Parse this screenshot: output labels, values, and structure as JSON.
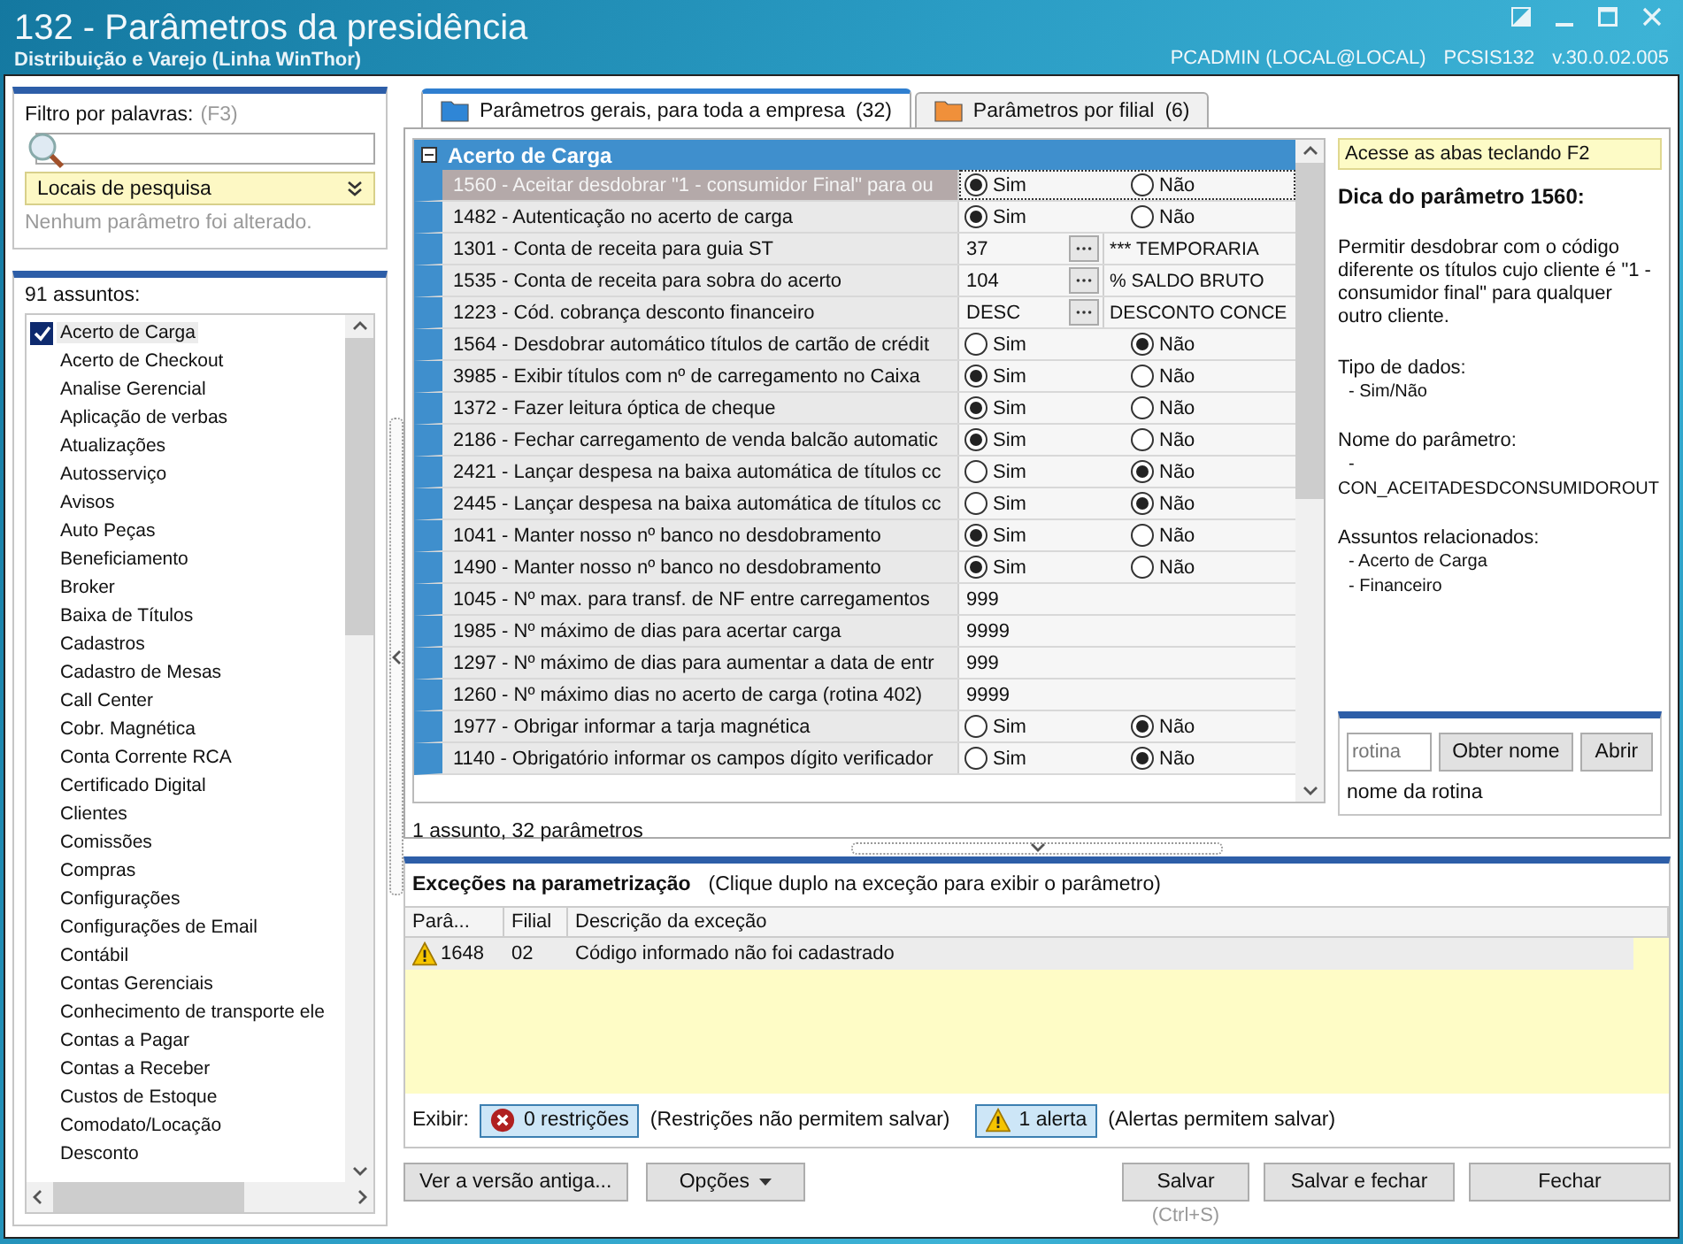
{
  "window": {
    "title": "132 - Parâmetros da presidência",
    "subtitle": "Distribuição e Varejo (Linha WinThor)",
    "user": "PCADMIN (LOCAL@LOCAL)",
    "system": "PCSIS132",
    "version": "v.30.0.02.005"
  },
  "filter": {
    "label": "Filtro por palavras:",
    "shortcut": "(F3)",
    "search_locations": "Locais de pesquisa",
    "status": "Nenhum parâmetro foi alterado."
  },
  "subjects": {
    "count_label": "91 assuntos:",
    "items": [
      {
        "label": "Acerto de Carga",
        "checked": true,
        "selected": true
      },
      {
        "label": "Acerto de Checkout",
        "checked": false,
        "selected": false
      },
      {
        "label": "Analise Gerencial",
        "checked": false,
        "selected": false
      },
      {
        "label": "Aplicação de verbas",
        "checked": false,
        "selected": false
      },
      {
        "label": "Atualizações",
        "checked": false,
        "selected": false
      },
      {
        "label": "Autosserviço",
        "checked": false,
        "selected": false
      },
      {
        "label": "Avisos",
        "checked": false,
        "selected": false
      },
      {
        "label": "Auto Peças",
        "checked": false,
        "selected": false
      },
      {
        "label": "Beneficiamento",
        "checked": false,
        "selected": false
      },
      {
        "label": "Broker",
        "checked": false,
        "selected": false
      },
      {
        "label": "Baixa de Títulos",
        "checked": false,
        "selected": false
      },
      {
        "label": "Cadastros",
        "checked": false,
        "selected": false
      },
      {
        "label": "Cadastro de Mesas",
        "checked": false,
        "selected": false
      },
      {
        "label": "Call Center",
        "checked": false,
        "selected": false
      },
      {
        "label": "Cobr. Magnética",
        "checked": false,
        "selected": false
      },
      {
        "label": "Conta Corrente RCA",
        "checked": false,
        "selected": false
      },
      {
        "label": "Certificado Digital",
        "checked": false,
        "selected": false
      },
      {
        "label": "Clientes",
        "checked": false,
        "selected": false
      },
      {
        "label": "Comissões",
        "checked": false,
        "selected": false
      },
      {
        "label": "Compras",
        "checked": false,
        "selected": false
      },
      {
        "label": "Configurações",
        "checked": false,
        "selected": false
      },
      {
        "label": "Configurações de Email",
        "checked": false,
        "selected": false
      },
      {
        "label": "Contábil",
        "checked": false,
        "selected": false
      },
      {
        "label": "Contas Gerenciais",
        "checked": false,
        "selected": false
      },
      {
        "label": "Conhecimento de transporte ele",
        "checked": false,
        "selected": false
      },
      {
        "label": "Contas a Pagar",
        "checked": false,
        "selected": false
      },
      {
        "label": "Contas a Receber",
        "checked": false,
        "selected": false
      },
      {
        "label": "Custos de Estoque",
        "checked": false,
        "selected": false
      },
      {
        "label": "Comodato/Locação",
        "checked": false,
        "selected": false
      },
      {
        "label": "Desconto",
        "checked": false,
        "selected": false
      }
    ]
  },
  "tabs": [
    {
      "label": "Parâmetros gerais, para toda a empresa",
      "count": "(32)",
      "selected": true,
      "color": "#2f86d6"
    },
    {
      "label": "Parâmetros por filial",
      "count": "(6)",
      "selected": false,
      "color": "#f0903a"
    }
  ],
  "grid": {
    "group": {
      "title": "Acerto de Carga",
      "expanded": true
    },
    "rows": [
      {
        "kind": "radio",
        "label": "1560 - Aceitar desdobrar \"1 - consumidor Final\" para ou",
        "selected": true,
        "options": [
          {
            "label": "Sim",
            "selected": true
          },
          {
            "label": "Não",
            "selected": false
          }
        ]
      },
      {
        "kind": "radio",
        "label": "1482 - Autenticação no acerto de carga",
        "selected": false,
        "options": [
          {
            "label": "Sim",
            "selected": true
          },
          {
            "label": "Não",
            "selected": false
          }
        ]
      },
      {
        "kind": "lookup",
        "label": "1301 - Conta de receita para guia ST",
        "selected": false,
        "value": "37",
        "description": "*** TEMPORARIA"
      },
      {
        "kind": "lookup",
        "label": "1535 - Conta de receita para sobra do acerto",
        "selected": false,
        "value": "104",
        "description": "% SALDO BRUTO"
      },
      {
        "kind": "lookup",
        "label": "1223 - Cód. cobrança desconto financeiro",
        "selected": false,
        "value": "DESC",
        "description": "DESCONTO CONCE"
      },
      {
        "kind": "radio",
        "label": "1564 - Desdobrar automático títulos de cartão de crédit",
        "selected": false,
        "options": [
          {
            "label": "Sim",
            "selected": false
          },
          {
            "label": "Não",
            "selected": true
          }
        ]
      },
      {
        "kind": "radio",
        "label": "3985 - Exibir títulos com nº de carregamento no Caixa",
        "selected": false,
        "options": [
          {
            "label": "Sim",
            "selected": true
          },
          {
            "label": "Não",
            "selected": false
          }
        ]
      },
      {
        "kind": "radio",
        "label": "1372 - Fazer leitura óptica de cheque",
        "selected": false,
        "options": [
          {
            "label": "Sim",
            "selected": true
          },
          {
            "label": "Não",
            "selected": false
          }
        ]
      },
      {
        "kind": "radio",
        "label": "2186 - Fechar carregamento de venda balcão automatic",
        "selected": false,
        "options": [
          {
            "label": "Sim",
            "selected": true
          },
          {
            "label": "Não",
            "selected": false
          }
        ]
      },
      {
        "kind": "radio",
        "label": "2421 - Lançar despesa na baixa automática de títulos cc",
        "selected": false,
        "options": [
          {
            "label": "Sim",
            "selected": false
          },
          {
            "label": "Não",
            "selected": true
          }
        ]
      },
      {
        "kind": "radio",
        "label": "2445 - Lançar despesa na baixa automática de títulos cc",
        "selected": false,
        "options": [
          {
            "label": "Sim",
            "selected": false
          },
          {
            "label": "Não",
            "selected": true
          }
        ]
      },
      {
        "kind": "radio",
        "label": "1041 - Manter nosso nº banco no desdobramento",
        "selected": false,
        "options": [
          {
            "label": "Sim",
            "selected": true
          },
          {
            "label": "Não",
            "selected": false
          }
        ]
      },
      {
        "kind": "radio",
        "label": "1490 - Manter nosso nº banco no desdobramento",
        "selected": false,
        "options": [
          {
            "label": "Sim",
            "selected": true
          },
          {
            "label": "Não",
            "selected": false
          }
        ]
      },
      {
        "kind": "number",
        "label": "1045 - Nº max. para transf. de NF entre carregamentos",
        "selected": false,
        "value": "999"
      },
      {
        "kind": "number",
        "label": "1985 - Nº máximo de dias para acertar carga",
        "selected": false,
        "value": "9999"
      },
      {
        "kind": "number",
        "label": "1297 - Nº máximo de dias para aumentar a data de entr",
        "selected": false,
        "value": "999"
      },
      {
        "kind": "number",
        "label": "1260 - Nº máximo dias no acerto de carga (rotina 402)",
        "selected": false,
        "value": "9999"
      },
      {
        "kind": "radio",
        "label": "1977 - Obrigar informar a tarja magnética",
        "selected": false,
        "options": [
          {
            "label": "Sim",
            "selected": false
          },
          {
            "label": "Não",
            "selected": true
          }
        ]
      },
      {
        "kind": "radio",
        "label": "1140 - Obrigatório informar os campos dígito verificador",
        "selected": false,
        "options": [
          {
            "label": "Sim",
            "selected": false
          },
          {
            "label": "Não",
            "selected": true
          }
        ]
      }
    ],
    "status": "1 assunto, 32 parâmetros"
  },
  "info": {
    "hint": "Acesse as abas teclando F2",
    "title": "Dica do parâmetro 1560:",
    "description": "Permitir desdobrar com o código diferente os títulos cujo cliente é \"1 - consumidor final\" para qualquer outro cliente.",
    "sections": [
      {
        "heading": "Tipo de dados:",
        "items": [
          "- Sim/Não"
        ]
      },
      {
        "heading": "Nome do parâmetro:",
        "items": [
          "-",
          "CON_ACEITADESDCONSUMIDOROUT"
        ]
      },
      {
        "heading": "Assuntos relacionados:",
        "items": [
          "- Acerto de Carga",
          "- Financeiro"
        ]
      }
    ]
  },
  "routine": {
    "placeholder": "rotina",
    "buttons": [
      "Obter nome",
      "Abrir"
    ],
    "result": "nome da rotina"
  },
  "exceptions": {
    "title": "Exceções na parametrização",
    "hint": "(Clique duplo na exceção para exibir o parâmetro)",
    "columns": [
      "Parâ...",
      "Filial",
      "Descrição da exceção"
    ],
    "rows": [
      {
        "kind": "alert",
        "param": "1648",
        "branch": "02",
        "description": "Código informado não foi cadastrado"
      }
    ],
    "filter_label": "Exibir:",
    "toggles": [
      {
        "kind": "restriction",
        "label": "0 restrições",
        "note": "(Restrições não permitem salvar)",
        "selected": true
      },
      {
        "kind": "alert",
        "label": "1 alerta",
        "note": "(Alertas permitem salvar)",
        "selected": true
      }
    ]
  },
  "footer": {
    "left": [
      {
        "kind": "plain",
        "label": "Ver a versão antiga..."
      },
      {
        "kind": "menu",
        "label": "Opções"
      }
    ],
    "right": [
      {
        "label": "Salvar",
        "shortcut": "(Ctrl+S)"
      },
      {
        "label": "Salvar e fechar"
      },
      {
        "label": "Fechar"
      }
    ]
  }
}
